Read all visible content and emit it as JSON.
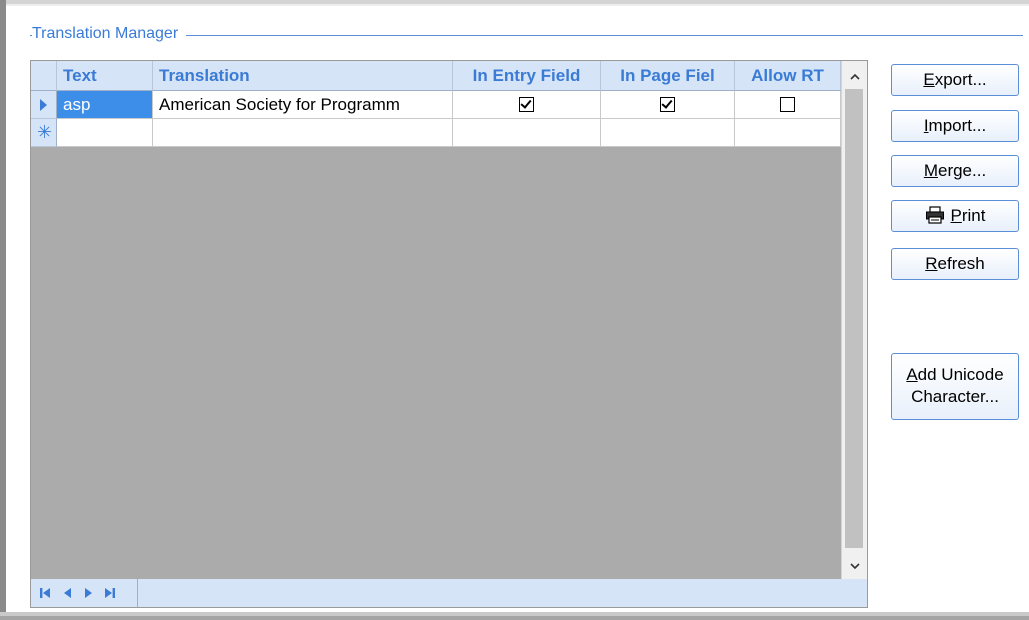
{
  "group": {
    "title": "Translation Manager"
  },
  "columns": [
    "Text",
    "Translation",
    "In Entry Field",
    "In Page Fiel",
    "Allow RT"
  ],
  "rows": [
    {
      "text": "asp",
      "translation": "American Society for Programm",
      "in_entry_field": true,
      "in_page_field": true,
      "allow_rt": false
    }
  ],
  "buttons": {
    "export": {
      "mnemonic": "E",
      "rest": "xport..."
    },
    "import": {
      "mnemonic": "I",
      "rest": "mport..."
    },
    "merge": {
      "mnemonic": "M",
      "rest": "erge..."
    },
    "print": {
      "mnemonic": "P",
      "rest": "rint"
    },
    "refresh": {
      "mnemonic": "R",
      "rest": "efresh"
    },
    "add_unicode": {
      "mnemonic": "A",
      "line1_rest": "dd Unicode",
      "line2": "Character..."
    }
  },
  "colors": {
    "accent": "#3a7bd5",
    "header_bg": "#d6e4f7",
    "grid_empty": "#ababab",
    "selected": "#3d8ee8"
  },
  "icons": {
    "row_indicator": "current-row-triangle-icon",
    "new_row": "new-row-asterisk-icon",
    "print": "printer-icon",
    "nav": [
      "first-record-icon",
      "previous-record-icon",
      "next-record-icon",
      "last-record-icon"
    ]
  }
}
